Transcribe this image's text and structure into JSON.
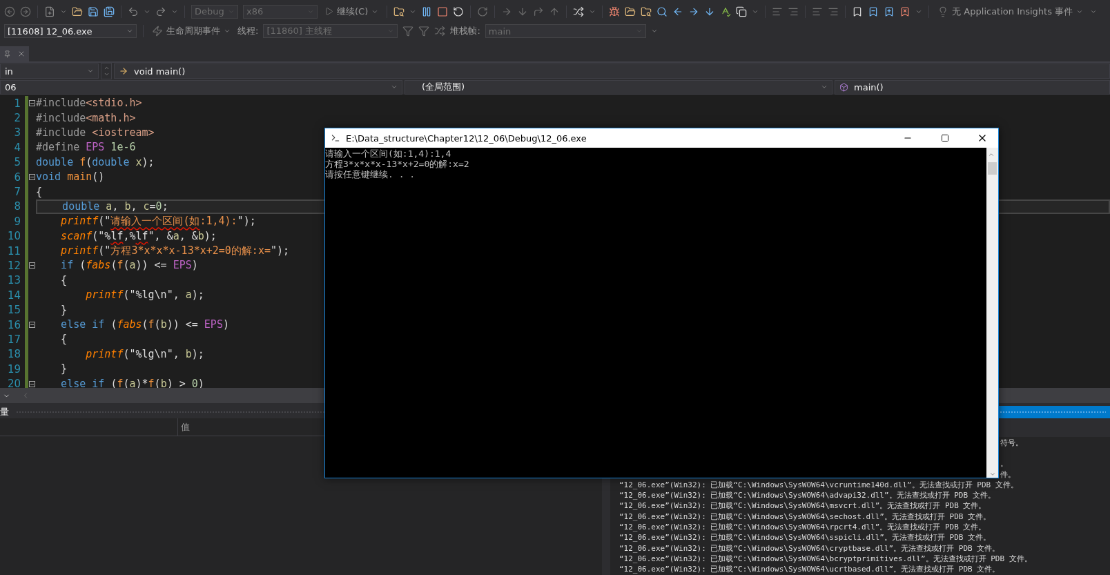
{
  "toolbar": {
    "configuration": {
      "value": "Debug",
      "disabled": true
    },
    "platform": {
      "value": "x86",
      "disabled": true
    },
    "continue_button": {
      "label": "继续(C)"
    },
    "insights": {
      "label": "无 Application Insights 事件"
    }
  },
  "debug_location": {
    "process": {
      "value": "[11608] 12_06.exe",
      "disabled": false
    },
    "lifecycle_events": {
      "label": "生命周期事件"
    },
    "thread_label": "线程:",
    "thread": {
      "value": "[11860] 主线程",
      "disabled": true
    },
    "stack_frame_label": "堆栈帧:",
    "stack_frame": {
      "value": "main",
      "disabled": true
    }
  },
  "navigation": {
    "member_dropdown": "in",
    "current_function": "void main()",
    "file_dropdown": "06",
    "scope_dropdown": "(全局范围)",
    "function_dropdown": "main()"
  },
  "editor": {
    "lines": [
      {
        "number": "1",
        "fold": true,
        "current": false,
        "tokens": [
          {
            "text": "#include",
            "kind": "pre"
          },
          {
            "text": "<stdio.h>",
            "kind": "hdr"
          }
        ]
      },
      {
        "number": "2",
        "fold": false,
        "current": false,
        "tokens": [
          {
            "text": "#include",
            "kind": "pre"
          },
          {
            "text": "<math.h>",
            "kind": "hdr"
          }
        ]
      },
      {
        "number": "3",
        "fold": false,
        "current": false,
        "tokens": [
          {
            "text": "#include ",
            "kind": "pre"
          },
          {
            "text": "<iostream>",
            "kind": "hdr"
          }
        ]
      },
      {
        "number": "4",
        "fold": false,
        "current": false,
        "tokens": [
          {
            "text": "#define ",
            "kind": "pre"
          },
          {
            "text": "EPS",
            "kind": "macro"
          },
          {
            "text": " 1e-6",
            "kind": "num"
          }
        ]
      },
      {
        "number": "5",
        "fold": false,
        "current": false,
        "tokens": [
          {
            "text": "double ",
            "kind": "kw"
          },
          {
            "text": "f",
            "kind": "fn"
          },
          {
            "text": "(",
            "kind": "plain"
          },
          {
            "text": "double ",
            "kind": "kw"
          },
          {
            "text": "x",
            "kind": "var"
          },
          {
            "text": ");",
            "kind": "plain"
          }
        ]
      },
      {
        "number": "6",
        "fold": true,
        "current": false,
        "tokens": [
          {
            "text": "void ",
            "kind": "kw"
          },
          {
            "text": "main",
            "kind": "fn"
          },
          {
            "text": "()",
            "kind": "plain"
          }
        ]
      },
      {
        "number": "7",
        "fold": false,
        "current": false,
        "tokens": [
          {
            "text": "{",
            "kind": "plain"
          }
        ]
      },
      {
        "number": "8",
        "fold": false,
        "current": true,
        "tokens": [
          {
            "text": "    double ",
            "kind": "kw"
          },
          {
            "text": "a",
            "kind": "var"
          },
          {
            "text": ", ",
            "kind": "plain"
          },
          {
            "text": "b",
            "kind": "var"
          },
          {
            "text": ", ",
            "kind": "plain"
          },
          {
            "text": "c",
            "kind": "var"
          },
          {
            "text": "=",
            "kind": "plain"
          },
          {
            "text": "0",
            "kind": "num"
          },
          {
            "text": ";",
            "kind": "plain"
          }
        ]
      },
      {
        "number": "9",
        "fold": false,
        "current": false,
        "tokens": [
          {
            "text": "    printf",
            "kind": "call"
          },
          {
            "text": "(",
            "kind": "plain"
          },
          {
            "text": "\"",
            "kind": "fmt"
          },
          {
            "text": "请输入一个区间(如",
            "kind": "str",
            "err": true
          },
          {
            "text": ":1,4):",
            "kind": "str"
          },
          {
            "text": "\"",
            "kind": "fmt"
          },
          {
            "text": ");",
            "kind": "plain"
          }
        ]
      },
      {
        "number": "10",
        "fold": false,
        "current": false,
        "tokens": [
          {
            "text": "    scanf",
            "kind": "call"
          },
          {
            "text": "(",
            "kind": "plain"
          },
          {
            "text": "\"%",
            "kind": "fmt"
          },
          {
            "text": "lf",
            "kind": "fmt",
            "err": true
          },
          {
            "text": ",%",
            "kind": "fmt"
          },
          {
            "text": "lf",
            "kind": "fmt",
            "err": true
          },
          {
            "text": "\"",
            "kind": "fmt"
          },
          {
            "text": ", &",
            "kind": "plain"
          },
          {
            "text": "a",
            "kind": "var"
          },
          {
            "text": ", &",
            "kind": "plain"
          },
          {
            "text": "b",
            "kind": "var"
          },
          {
            "text": ");",
            "kind": "plain"
          }
        ]
      },
      {
        "number": "11",
        "fold": false,
        "current": false,
        "tokens": [
          {
            "text": "    printf",
            "kind": "call"
          },
          {
            "text": "(",
            "kind": "plain"
          },
          {
            "text": "\"",
            "kind": "fmt"
          },
          {
            "text": "方程3*x*x*x-13*x+2=0的解:x=",
            "kind": "str"
          },
          {
            "text": "\"",
            "kind": "fmt"
          },
          {
            "text": ");",
            "kind": "plain"
          }
        ]
      },
      {
        "number": "12",
        "fold": true,
        "current": false,
        "tokens": [
          {
            "text": "    if ",
            "kind": "kw"
          },
          {
            "text": "(",
            "kind": "plain"
          },
          {
            "text": "fabs",
            "kind": "call"
          },
          {
            "text": "(",
            "kind": "plain"
          },
          {
            "text": "f",
            "kind": "fn"
          },
          {
            "text": "(",
            "kind": "plain"
          },
          {
            "text": "a",
            "kind": "var"
          },
          {
            "text": ")) <= ",
            "kind": "plain"
          },
          {
            "text": "EPS",
            "kind": "macro"
          },
          {
            "text": ")",
            "kind": "plain"
          }
        ]
      },
      {
        "number": "13",
        "fold": false,
        "current": false,
        "tokens": [
          {
            "text": "    {",
            "kind": "plain"
          }
        ]
      },
      {
        "number": "14",
        "fold": false,
        "current": false,
        "tokens": [
          {
            "text": "        printf",
            "kind": "call"
          },
          {
            "text": "(",
            "kind": "plain"
          },
          {
            "text": "\"%lg\\n\"",
            "kind": "fmt"
          },
          {
            "text": ", ",
            "kind": "plain"
          },
          {
            "text": "a",
            "kind": "var"
          },
          {
            "text": ");",
            "kind": "plain"
          }
        ]
      },
      {
        "number": "15",
        "fold": false,
        "current": false,
        "tokens": [
          {
            "text": "    }",
            "kind": "plain"
          }
        ]
      },
      {
        "number": "16",
        "fold": true,
        "current": false,
        "tokens": [
          {
            "text": "    else if ",
            "kind": "kw"
          },
          {
            "text": "(",
            "kind": "plain"
          },
          {
            "text": "fabs",
            "kind": "call"
          },
          {
            "text": "(",
            "kind": "plain"
          },
          {
            "text": "f",
            "kind": "fn"
          },
          {
            "text": "(",
            "kind": "plain"
          },
          {
            "text": "b",
            "kind": "var"
          },
          {
            "text": ")) <= ",
            "kind": "plain"
          },
          {
            "text": "EPS",
            "kind": "macro"
          },
          {
            "text": ")",
            "kind": "plain"
          }
        ]
      },
      {
        "number": "17",
        "fold": false,
        "current": false,
        "tokens": [
          {
            "text": "    {",
            "kind": "plain"
          }
        ]
      },
      {
        "number": "18",
        "fold": false,
        "current": false,
        "tokens": [
          {
            "text": "        printf",
            "kind": "call"
          },
          {
            "text": "(",
            "kind": "plain"
          },
          {
            "text": "\"%lg\\n\"",
            "kind": "fmt"
          },
          {
            "text": ", ",
            "kind": "plain"
          },
          {
            "text": "b",
            "kind": "var"
          },
          {
            "text": ");",
            "kind": "plain"
          }
        ]
      },
      {
        "number": "19",
        "fold": false,
        "current": false,
        "tokens": [
          {
            "text": "    }",
            "kind": "plain"
          }
        ]
      },
      {
        "number": "20",
        "fold": true,
        "current": false,
        "tokens": [
          {
            "text": "    else if ",
            "kind": "kw"
          },
          {
            "text": "(",
            "kind": "plain"
          },
          {
            "text": "f",
            "kind": "fn"
          },
          {
            "text": "(",
            "kind": "plain"
          },
          {
            "text": "a",
            "kind": "var"
          },
          {
            "text": ")*",
            "kind": "plain"
          },
          {
            "text": "f",
            "kind": "fn"
          },
          {
            "text": "(",
            "kind": "plain"
          },
          {
            "text": "b",
            "kind": "var"
          },
          {
            "text": ") > ",
            "kind": "plain"
          },
          {
            "text": "0",
            "kind": "num"
          },
          {
            "text": ")",
            "kind": "plain"
          }
        ]
      }
    ]
  },
  "locals_panel": {
    "title": "量",
    "column_2": "值"
  },
  "output_panel": {
    "lines": [
      {
        "kind": "tail",
        "text": "符号。"
      },
      {
        "kind": "tail",
        "text": "。"
      },
      {
        "kind": "tail",
        "text": "件。"
      },
      {
        "kind": "full",
        "text": "“12_06.exe”(Win32): 已加载“C:\\Windows\\SysWOW64\\vcruntime140d.dll”。无法查找或打开 PDB 文件。"
      },
      {
        "kind": "full",
        "text": "“12_06.exe”(Win32): 已加载“C:\\Windows\\SysWOW64\\advapi32.dll”。无法查找或打开 PDB 文件。"
      },
      {
        "kind": "full",
        "text": "“12_06.exe”(Win32): 已加载“C:\\Windows\\SysWOW64\\msvcrt.dll”。无法查找或打开 PDB 文件。"
      },
      {
        "kind": "full",
        "text": "“12_06.exe”(Win32): 已加载“C:\\Windows\\SysWOW64\\sechost.dll”。无法查找或打开 PDB 文件。"
      },
      {
        "kind": "full",
        "text": "“12_06.exe”(Win32): 已加载“C:\\Windows\\SysWOW64\\rpcrt4.dll”。无法查找或打开 PDB 文件。"
      },
      {
        "kind": "full",
        "text": "“12_06.exe”(Win32): 已加载“C:\\Windows\\SysWOW64\\sspicli.dll”。无法查找或打开 PDB 文件。"
      },
      {
        "kind": "full",
        "text": "“12_06.exe”(Win32): 已加载“C:\\Windows\\SysWOW64\\cryptbase.dll”。无法查找或打开 PDB 文件。"
      },
      {
        "kind": "full",
        "text": "“12_06.exe”(Win32): 已加载“C:\\Windows\\SysWOW64\\bcryptprimitives.dll”。无法查找或打开 PDB 文件。"
      },
      {
        "kind": "full",
        "text": "“12_06.exe”(Win32): 已加载“C:\\Windows\\SysWOW64\\ucrtbased.dll”。无法查找或打开 PDB 文件。"
      }
    ]
  },
  "console": {
    "title": "E:\\Data_structure\\Chapter12\\12_06\\Debug\\12_06.exe",
    "lines": [
      "请输入一个区间(如:1,4):1,4",
      "方程3*x*x*x-13*x+2=0的解:x=2",
      "请按任意键继续. . ."
    ]
  }
}
